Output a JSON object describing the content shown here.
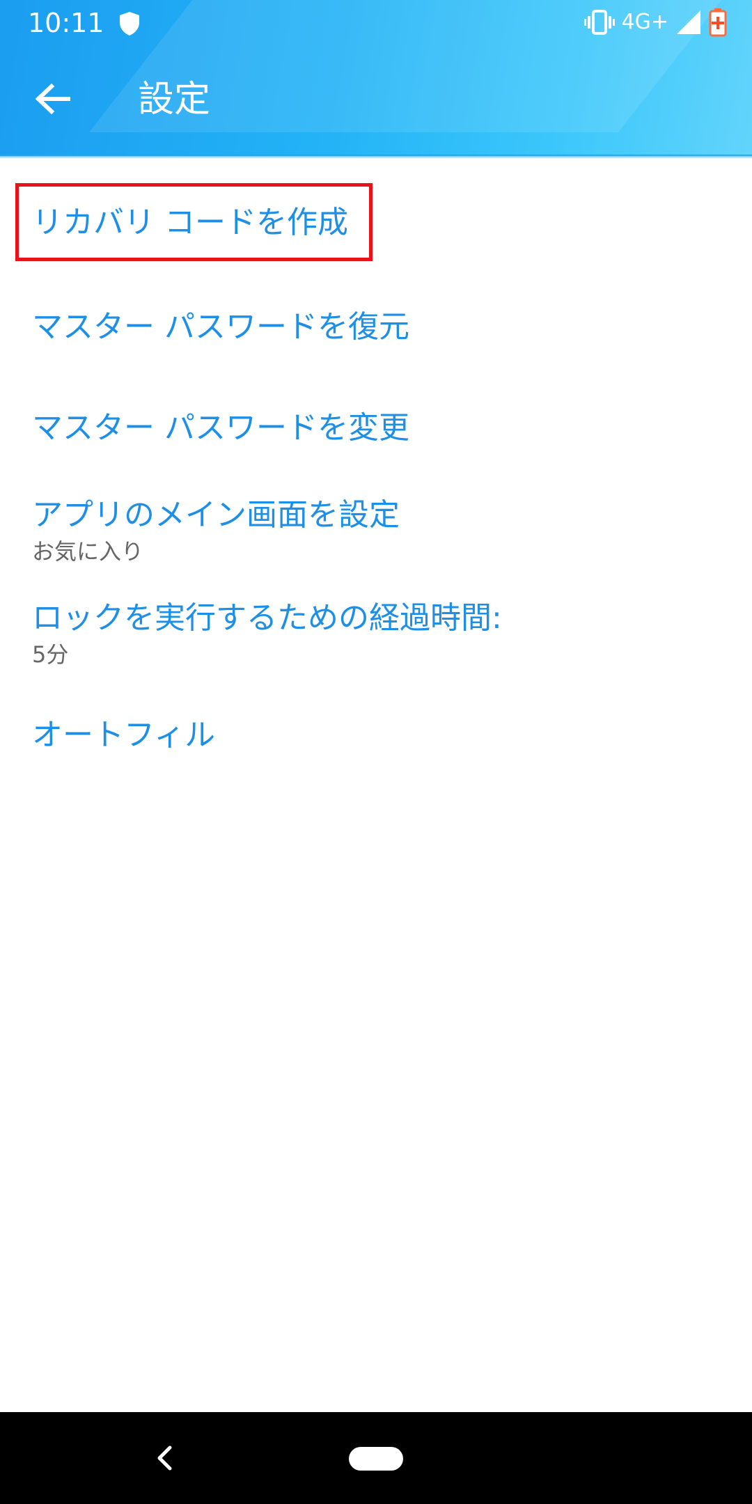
{
  "status_bar": {
    "time": "10:11",
    "network": "4G+",
    "icons": [
      "shield-icon",
      "vibrate-icon",
      "signal-icon",
      "battery-charging-icon"
    ]
  },
  "app_bar": {
    "title": "設定",
    "back_icon": "arrow-back-icon"
  },
  "settings": {
    "items": [
      {
        "title": "リカバリ コードを作成"
      },
      {
        "title": "マスター パスワードを復元"
      },
      {
        "title": "マスター パスワードを変更"
      },
      {
        "title": "アプリのメイン画面を設定",
        "summary": "お気に入り"
      },
      {
        "title": "ロックを実行するための経過時間:",
        "summary": "5分"
      },
      {
        "title": "オートフィル"
      }
    ]
  },
  "highlight": {
    "color": "#e8121b",
    "target": "リカバリ コードを作成"
  },
  "colors": {
    "accent": "#1e8fe6",
    "header": "#23b3f6",
    "summary_text": "#666666",
    "navbar": "#000000"
  },
  "nav_bar": {
    "icons": [
      "nav-back-icon",
      "nav-home-pill"
    ]
  }
}
